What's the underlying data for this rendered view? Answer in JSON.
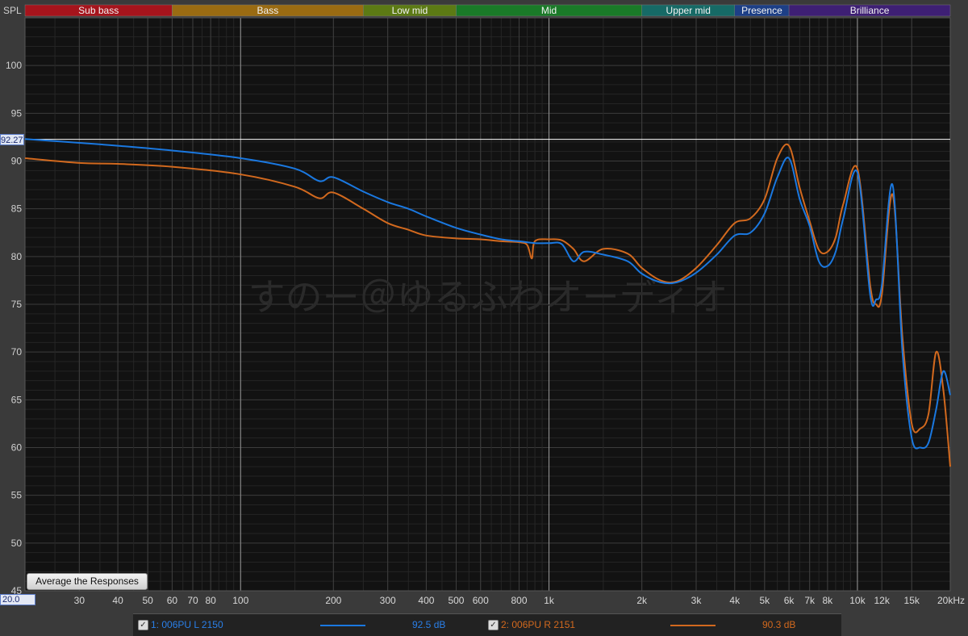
{
  "chart_data": {
    "type": "line",
    "ylabel": "SPL",
    "ylim": [
      45,
      105
    ],
    "xlim": [
      20,
      20000
    ],
    "x_scale": "log",
    "grid": true,
    "y_ticks": [
      100,
      95,
      90,
      85,
      80,
      75,
      70,
      65,
      60,
      55,
      50,
      45
    ],
    "x_ticks": [
      {
        "f": 30,
        "label": "30"
      },
      {
        "f": 40,
        "label": "40"
      },
      {
        "f": 50,
        "label": "50"
      },
      {
        "f": 60,
        "label": "60"
      },
      {
        "f": 70,
        "label": "70"
      },
      {
        "f": 80,
        "label": "80"
      },
      {
        "f": 100,
        "label": "100"
      },
      {
        "f": 200,
        "label": "200"
      },
      {
        "f": 300,
        "label": "300"
      },
      {
        "f": 400,
        "label": "400"
      },
      {
        "f": 500,
        "label": "500"
      },
      {
        "f": 600,
        "label": "600"
      },
      {
        "f": 800,
        "label": "800"
      },
      {
        "f": 1000,
        "label": "1k"
      },
      {
        "f": 2000,
        "label": "2k"
      },
      {
        "f": 3000,
        "label": "3k"
      },
      {
        "f": 4000,
        "label": "4k"
      },
      {
        "f": 5000,
        "label": "5k"
      },
      {
        "f": 6000,
        "label": "6k"
      },
      {
        "f": 7000,
        "label": "7k"
      },
      {
        "f": 8000,
        "label": "8k"
      },
      {
        "f": 10000,
        "label": "10k"
      },
      {
        "f": 12000,
        "label": "12k"
      },
      {
        "f": 15000,
        "label": "15k"
      },
      {
        "f": 20000,
        "label": "20kHz"
      }
    ],
    "bands": [
      {
        "name": "Sub bass",
        "from": 20,
        "to": 60,
        "color": "#a6141c"
      },
      {
        "name": "Bass",
        "from": 60,
        "to": 250,
        "color": "#9a6b12"
      },
      {
        "name": "Low mid",
        "from": 250,
        "to": 500,
        "color": "#5c7a14"
      },
      {
        "name": "Mid",
        "from": 500,
        "to": 2000,
        "color": "#1a7a28"
      },
      {
        "name": "Upper mid",
        "from": 2000,
        "to": 4000,
        "color": "#166a66"
      },
      {
        "name": "Presence",
        "from": 4000,
        "to": 6000,
        "color": "#1d3f86"
      },
      {
        "name": "Brilliance",
        "from": 6000,
        "to": 20000,
        "color": "#3e1f74"
      }
    ],
    "cursor_value": 92.27,
    "series": [
      {
        "name": "1: 006PU L 2150",
        "color": "#1a78e0",
        "x": [
          20,
          30,
          40,
          60,
          100,
          150,
          180,
          200,
          250,
          300,
          350,
          400,
          500,
          600,
          700,
          800,
          900,
          1000,
          1100,
          1200,
          1300,
          1500,
          1800,
          2000,
          2300,
          2600,
          3000,
          3500,
          4000,
          4500,
          5000,
          5500,
          6000,
          6500,
          7000,
          7500,
          8000,
          8500,
          9000,
          10000,
          11000,
          11500,
          12000,
          13000,
          14000,
          15000,
          16000,
          17000,
          18000,
          19000,
          20000
        ],
        "values": [
          92.3,
          91.9,
          91.6,
          91.1,
          90.3,
          89.2,
          87.9,
          88.3,
          86.8,
          85.7,
          85,
          84.2,
          83,
          82.3,
          81.8,
          81.6,
          81.4,
          81.4,
          81.3,
          79.5,
          80.5,
          80.2,
          79.5,
          78.2,
          77.3,
          77.3,
          78.3,
          80.2,
          82.2,
          82.5,
          84.5,
          88.3,
          90.3,
          86,
          83.2,
          79.5,
          79,
          80.5,
          84,
          88.8,
          76,
          75.5,
          77,
          87.5,
          70,
          61,
          60,
          60.5,
          64,
          68,
          65.5
        ]
      },
      {
        "name": "2: 006PU R 2151",
        "color": "#d2691e",
        "x": [
          20,
          30,
          40,
          60,
          100,
          150,
          180,
          200,
          250,
          300,
          350,
          400,
          500,
          600,
          700,
          800,
          850,
          880,
          900,
          1000,
          1100,
          1200,
          1300,
          1500,
          1800,
          2000,
          2300,
          2600,
          3000,
          3500,
          4000,
          4500,
          5000,
          5500,
          6000,
          6500,
          7000,
          7500,
          8000,
          8500,
          9000,
          10000,
          11000,
          11500,
          12000,
          13000,
          14000,
          15000,
          16000,
          17000,
          18000,
          19000,
          20000
        ],
        "values": [
          90.3,
          89.8,
          89.7,
          89.4,
          88.6,
          87.3,
          86.1,
          86.7,
          85,
          83.5,
          82.8,
          82.2,
          81.9,
          81.8,
          81.6,
          81.5,
          81.2,
          79.8,
          81.6,
          81.8,
          81.7,
          80.8,
          79.5,
          80.8,
          80.3,
          78.8,
          77.5,
          77.4,
          78.8,
          81.2,
          83.5,
          84,
          86,
          90.3,
          91.6,
          87.2,
          83.7,
          80.7,
          80.5,
          82,
          85.5,
          89.2,
          77,
          75,
          76,
          86.5,
          71.5,
          62.5,
          62,
          63.5,
          70,
          66,
          58
        ]
      }
    ],
    "legend": {
      "items": [
        {
          "label": "1: 006PU L 2150",
          "value": "92.5 dB",
          "color": "#1a78e0"
        },
        {
          "label": "2: 006PU R 2151",
          "value": "90.3 dB",
          "color": "#d2691e"
        }
      ]
    },
    "watermark": "すのー＠ゆるふわオーディオ",
    "x_start_label": "20.0",
    "cursor_label": "92.27",
    "button_label": "Average the Responses"
  }
}
